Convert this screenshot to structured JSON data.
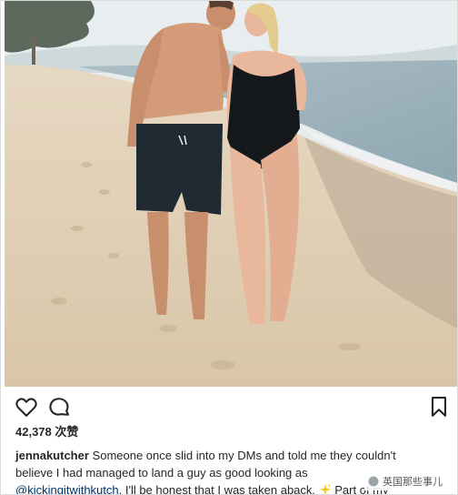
{
  "post": {
    "image_alt": "Couple kissing on a beach",
    "likes": "42,378 次赞",
    "username": "jennakutcher",
    "caption_line1": "Someone once slid into my DMs and told me they couldn't",
    "caption_line2": "believe I had managed to land a guy as good looking as",
    "mention": "@kickingitwithkutch",
    "caption_line3_tail": ". I'll be honest that I was taken aback.",
    "caption_line3_end": "Part of my"
  },
  "icons": {
    "like": "heart-icon",
    "comment": "comment-icon",
    "bookmark": "bookmark-icon",
    "emoji": "sparkles-emoji"
  },
  "watermark": {
    "text": "英国那些事儿"
  },
  "colors": {
    "text": "#262626",
    "mention": "#003569",
    "border": "#dbdbdb"
  }
}
